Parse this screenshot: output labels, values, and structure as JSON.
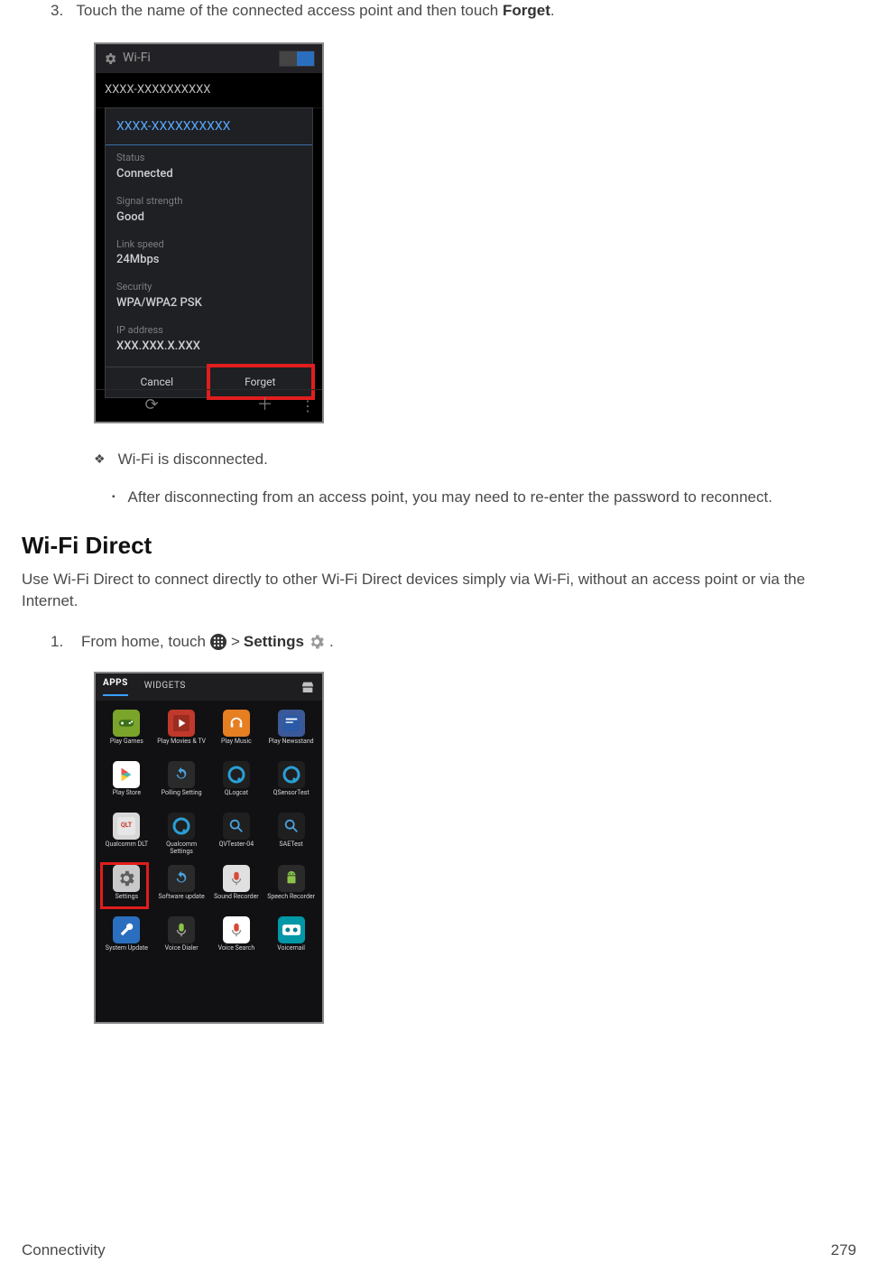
{
  "step3": {
    "num": "3.",
    "text_a": "Touch the name of the connected access point and then touch ",
    "text_b": "Forget",
    "text_c": "."
  },
  "shot1": {
    "title": "Wi-Fi",
    "bg_network": "XXXX-XXXXXXXXXX",
    "dialog": {
      "title": "XXXX-XXXXXXXXXX",
      "fields": [
        {
          "label": "Status",
          "value": "Connected"
        },
        {
          "label": "Signal strength",
          "value": "Good"
        },
        {
          "label": "Link speed",
          "value": "24Mbps"
        },
        {
          "label": "Security",
          "value": "WPA/WPA2 PSK"
        },
        {
          "label": "IP address",
          "value": "XXX.XXX.X.XXX"
        }
      ],
      "cancel": "Cancel",
      "forget": "Forget"
    }
  },
  "bullet1": "Wi-Fi is disconnected.",
  "bullet2": "After disconnecting from an access point, you may need to re-enter the password to reconnect.",
  "section": {
    "heading": "Wi-Fi Direct",
    "desc": "Use Wi-Fi Direct to connect directly to other Wi-Fi Direct devices simply via Wi-Fi, without an access point or via the Internet."
  },
  "step1": {
    "num": "1.",
    "text_a": "From home, touch ",
    "text_b": " > ",
    "text_c": "Settings",
    "text_d": " ",
    "text_e": "."
  },
  "shot2": {
    "tab_apps": "APPS",
    "tab_widgets": "WIDGETS",
    "apps": [
      {
        "label": "Play Games",
        "bg": "#7aa52a",
        "glyph": "controller"
      },
      {
        "label": "Play Movies & TV",
        "bg": "#c0392b",
        "glyph": "film"
      },
      {
        "label": "Play Music",
        "bg": "#e67e22",
        "glyph": "headphones"
      },
      {
        "label": "Play Newsstand",
        "bg": "#3b5998",
        "glyph": "news"
      },
      {
        "label": "Play Store",
        "bg": "#ffffff",
        "glyph": "playstore"
      },
      {
        "label": "Polling Setting",
        "bg": "#2a2a2a",
        "glyph": "sync"
      },
      {
        "label": "QLogcat",
        "bg": "#1f1f1f",
        "glyph": "q-blue"
      },
      {
        "label": "QSensorTest",
        "bg": "#1f1f1f",
        "glyph": "q-blue"
      },
      {
        "label": "Qualcomm DLT",
        "bg": "#d8d8d8",
        "glyph": "qlt"
      },
      {
        "label": "Qualcomm Settings",
        "bg": "#1f1f1f",
        "glyph": "q-blue"
      },
      {
        "label": "QVTester-04",
        "bg": "#1f1f1f",
        "glyph": "search-blue"
      },
      {
        "label": "SAETest",
        "bg": "#1f1f1f",
        "glyph": "search-blue"
      },
      {
        "label": "Settings",
        "bg": "#c9c9c9",
        "glyph": "gear-dark"
      },
      {
        "label": "Software update",
        "bg": "#2a2a2a",
        "glyph": "sync"
      },
      {
        "label": "Sound Recorder",
        "bg": "#e0e0e0",
        "glyph": "mic-red"
      },
      {
        "label": "Speech Recorder",
        "bg": "#2a2a2a",
        "glyph": "android"
      },
      {
        "label": "System Update",
        "bg": "#2a6fbf",
        "glyph": "wrench"
      },
      {
        "label": "Voice Dialer",
        "bg": "#2a2a2a",
        "glyph": "mic"
      },
      {
        "label": "Voice Search",
        "bg": "#ffffff",
        "glyph": "mic-red"
      },
      {
        "label": "Voicemail",
        "bg": "#0097a7",
        "glyph": "tape"
      }
    ]
  },
  "footer": {
    "left": "Connectivity",
    "right": "279"
  }
}
